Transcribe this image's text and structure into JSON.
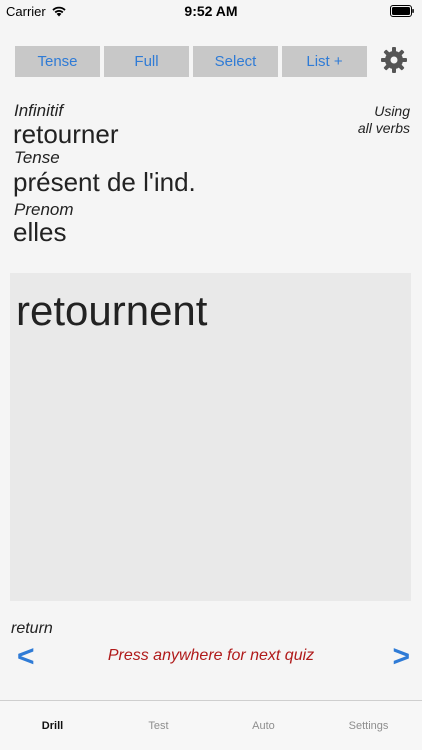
{
  "status_bar": {
    "carrier": "Carrier",
    "time": "9:52 AM"
  },
  "toolbar": {
    "tense_label": "Tense",
    "full_label": "Full",
    "select_label": "Select",
    "list_label": "List +",
    "settings_icon": "gear-icon"
  },
  "info": {
    "infinitif_label": "Infinitif",
    "infinitif_value": "retourner",
    "tense_label": "Tense",
    "tense_value": "présent de l'ind.",
    "prenom_label": "Prenom",
    "prenom_value": "elles",
    "using_line1": "Using",
    "using_line2": "all verbs"
  },
  "answer": {
    "text": "retournent"
  },
  "footer": {
    "translation": "return",
    "prev_symbol": "<",
    "next_symbol": ">",
    "hint": "Press anywhere for next quiz"
  },
  "tabs": [
    {
      "label": "Drill",
      "active": true
    },
    {
      "label": "Test",
      "active": false
    },
    {
      "label": "Auto",
      "active": false
    },
    {
      "label": "Settings",
      "active": false
    }
  ],
  "colors": {
    "accent": "#2f7bd6",
    "hint": "#b01a1a",
    "button_bg": "#c8c8c8",
    "answer_bg": "#e9e9e9"
  }
}
